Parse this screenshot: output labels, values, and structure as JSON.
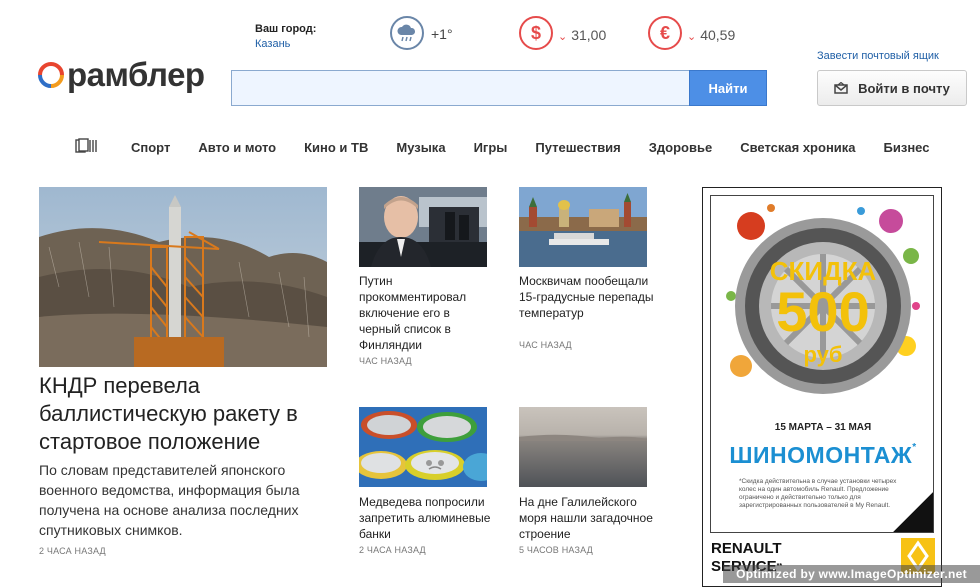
{
  "header": {
    "city_label": "Ваш город:",
    "city_value": "Казань",
    "weather": {
      "icon": "cloud-rain-icon",
      "value": "+1°"
    },
    "currencies": [
      {
        "icon": "dollar-icon",
        "symbol": "$",
        "value": "31,00",
        "trend": "down"
      },
      {
        "icon": "euro-icon",
        "symbol": "€",
        "value": "40,59",
        "trend": "down"
      }
    ],
    "create_mail_link": "Завести почтовый ящик",
    "logo_text": "рамблер",
    "search_placeholder": "",
    "search_button": "Найти",
    "mail_button": "Войти в почту",
    "colors": {
      "accent_blue": "#4d8fe6",
      "currency_red": "#e64b4b",
      "link_blue": "#1f5fa6"
    }
  },
  "nav": {
    "items": [
      "Спорт",
      "Авто и мото",
      "Кино и ТВ",
      "Музыка",
      "Игры",
      "Путешествия",
      "Здоровье",
      "Светская хроника",
      "Бизнес"
    ]
  },
  "main_story": {
    "title": "КНДР перевела баллистическую ракету в стартовое положение",
    "description": "По словам представителей японского военного ведомства, информация была получена на основе анализа последних спутниковых снимков.",
    "time": "2 ЧАСА НАЗАД"
  },
  "stories": [
    {
      "title": "Путин прокомментировал включение его в черный список в Финляндии",
      "time": "ЧАС НАЗАД"
    },
    {
      "title": "Москвичам пообещали 15-градусные перепады температур",
      "time": "ЧАС НАЗАД"
    },
    {
      "title": "Медведева попросили запретить алюминевые банки",
      "time": "2 ЧАСА НАЗАД"
    },
    {
      "title": "На дне Галилейского моря нашли загадочное строение",
      "time": "5 ЧАСОВ НАЗАД"
    }
  ],
  "ad": {
    "discount_word": "СКИДКА",
    "discount_amount": "500",
    "discount_currency": "руб",
    "dates": "15 МАРТА – 31 МАЯ",
    "service": "ШИНОМОНТАЖ",
    "service_mark": "*",
    "fine_print": "*Скидка действительна в случае установки четырех колес на один автомобиль Renault. Предложение ограничено и действительно только для зарегистрированных пользователей в My Renault.",
    "brand_line1": "RENAULT",
    "brand_line2": "SERVICE",
    "brand_mark": "**"
  },
  "watermark": "Optimized by www.ImageOptimizer.net"
}
